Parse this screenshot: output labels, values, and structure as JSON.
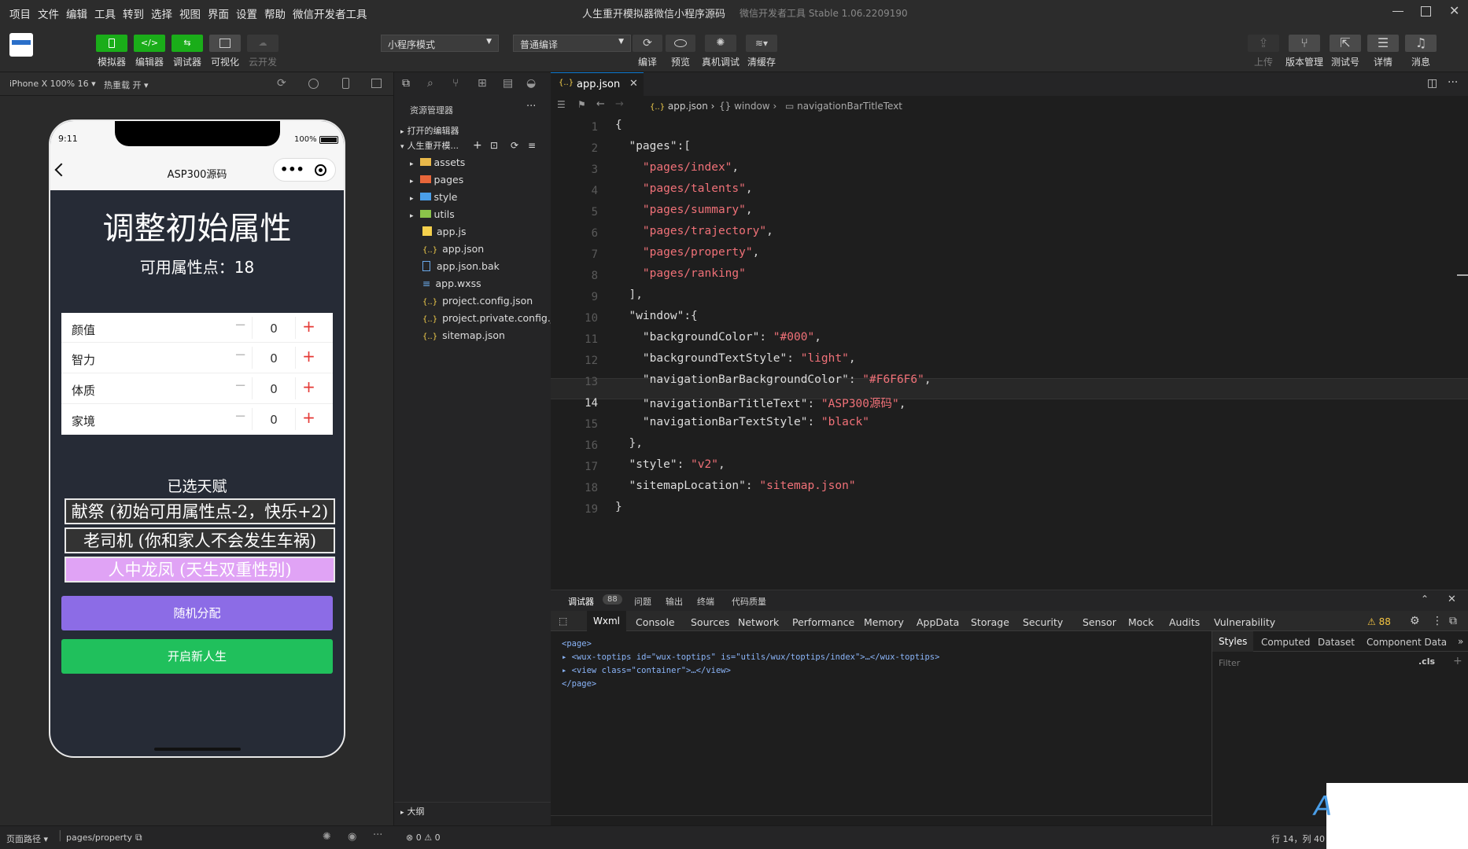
{
  "window": {
    "title": "人生重开模拟器微信小程序源码",
    "subtitle": "微信开发者工具 Stable 1.06.2209190"
  },
  "menu": [
    "项目",
    "文件",
    "编辑",
    "工具",
    "转到",
    "选择",
    "视图",
    "界面",
    "设置",
    "帮助",
    "微信开发者工具"
  ],
  "toolbar": {
    "left": [
      {
        "label": "模拟器",
        "icon": "phone-icon"
      },
      {
        "label": "编辑器",
        "icon": "code-icon"
      },
      {
        "label": "调试器",
        "icon": "debug-icon"
      },
      {
        "label": "可视化",
        "icon": "layout-icon"
      },
      {
        "label": "云开发",
        "icon": "cloud-icon"
      }
    ],
    "mode_select": "小程序模式",
    "compile_select": "普通编译",
    "mid": [
      {
        "label": "编译",
        "icon": "refresh-icon"
      },
      {
        "label": "预览",
        "icon": "eye-icon"
      },
      {
        "label": "真机调试",
        "icon": "bug-icon"
      },
      {
        "label": "清缓存",
        "icon": "layers-icon"
      }
    ],
    "right": [
      {
        "label": "上传",
        "icon": "upload-icon"
      },
      {
        "label": "版本管理",
        "icon": "branch-icon"
      },
      {
        "label": "测试号",
        "icon": "external-icon"
      },
      {
        "label": "详情",
        "icon": "menu-icon"
      },
      {
        "label": "消息",
        "icon": "bell-icon"
      }
    ]
  },
  "simulator": {
    "device": "iPhone X 100% 16",
    "hotreload": "热重载 开",
    "status_time": "9:11",
    "battery": "100%",
    "nav_title": "ASP300源码",
    "heading": "调整初始属性",
    "points_label": "可用属性点：18",
    "attributes": [
      {
        "name": "颜值",
        "value": "0"
      },
      {
        "name": "智力",
        "value": "0"
      },
      {
        "name": "体质",
        "value": "0"
      },
      {
        "name": "家境",
        "value": "0"
      }
    ],
    "talents_title": "已选天赋",
    "talents": [
      {
        "text": "献祭 (初始可用属性点-2，快乐+2)",
        "bg": "#333333",
        "color": "#ffffff"
      },
      {
        "text": "老司机 (你和家人不会发生车祸)",
        "bg": "#333333",
        "color": "#ffffff"
      },
      {
        "text": "人中龙凤 (天生双重性别)",
        "bg": "#e0a3f5",
        "color": "#ffffff"
      }
    ],
    "random_btn": "随机分配",
    "start_btn": "开启新人生"
  },
  "explorer": {
    "title": "资源管理器",
    "open_editors": "打开的编辑器",
    "project": "人生重开模...",
    "files": [
      {
        "name": "assets",
        "type": "folder",
        "color": "#e8b84a"
      },
      {
        "name": "pages",
        "type": "folder",
        "color": "#e8663a"
      },
      {
        "name": "style",
        "type": "folder",
        "color": "#4a9ee8"
      },
      {
        "name": "utils",
        "type": "folder",
        "color": "#8bc34a"
      },
      {
        "name": "app.js",
        "type": "js",
        "color": "#f5d04c"
      },
      {
        "name": "app.json",
        "type": "json",
        "color": "#f5d04c"
      },
      {
        "name": "app.json.bak",
        "type": "file",
        "color": "#6aa8e8"
      },
      {
        "name": "app.wxss",
        "type": "wxss",
        "color": "#6aa8e8"
      },
      {
        "name": "project.config.json",
        "type": "json",
        "color": "#f5d04c"
      },
      {
        "name": "project.private.config.js...",
        "type": "json",
        "color": "#f5d04c"
      },
      {
        "name": "sitemap.json",
        "type": "json",
        "color": "#f5d04c"
      }
    ],
    "outline": "大纲",
    "problems": "⊗ 0 ⚠ 0"
  },
  "editor": {
    "tab": "app.json",
    "breadcrumb": [
      "app.json",
      "window",
      "navigationBarTitleText"
    ],
    "active_line": 14,
    "lines": [
      {
        "n": "1",
        "code": "{"
      },
      {
        "n": "2",
        "code": "  \"pages\":["
      },
      {
        "n": "3",
        "code": "    \"pages/index\","
      },
      {
        "n": "4",
        "code": "    \"pages/talents\","
      },
      {
        "n": "5",
        "code": "    \"pages/summary\","
      },
      {
        "n": "6",
        "code": "    \"pages/trajectory\","
      },
      {
        "n": "7",
        "code": "    \"pages/property\","
      },
      {
        "n": "8",
        "code": "    \"pages/ranking\""
      },
      {
        "n": "9",
        "code": "  ],"
      },
      {
        "n": "10",
        "code": "  \"window\":{"
      },
      {
        "n": "11",
        "code": "    \"backgroundColor\": \"#000\","
      },
      {
        "n": "12",
        "code": "    \"backgroundTextStyle\": \"light\","
      },
      {
        "n": "13",
        "code": "    \"navigationBarBackgroundColor\": \"#F6F6F6\","
      },
      {
        "n": "14",
        "code": "    \"navigationBarTitleText\": \"ASP300源码\","
      },
      {
        "n": "15",
        "code": "    \"navigationBarTextStyle\": \"black\""
      },
      {
        "n": "16",
        "code": "  },"
      },
      {
        "n": "17",
        "code": "  \"style\": \"v2\","
      },
      {
        "n": "18",
        "code": "  \"sitemapLocation\": \"sitemap.json\""
      },
      {
        "n": "19",
        "code": "}"
      }
    ]
  },
  "devtools": {
    "top_tabs": [
      "调试器",
      "88",
      "问题",
      "输出",
      "终端",
      "代码质量"
    ],
    "tabs": [
      "Wxml",
      "Console",
      "Sources",
      "Network",
      "Performance",
      "Memory",
      "AppData",
      "Storage",
      "Security",
      "Sensor",
      "Mock",
      "Audits",
      "Vulnerability"
    ],
    "warn_count": "⚠ 88",
    "wxml": [
      "<page>",
      "▸ <wux-toptips id=\"wux-toptips\" is=\"utils/wux/toptips/index\">…</wux-toptips>",
      "▸ <view class=\"container\">…</view>",
      "</page>"
    ],
    "side_tabs": [
      "Styles",
      "Computed",
      "Dataset",
      "Component Data"
    ],
    "filter_placeholder": "Filter",
    "cls": ".cls"
  },
  "status": {
    "path_label": "页面路径",
    "path": "pages/property",
    "cursor": "行 14，列 40"
  }
}
